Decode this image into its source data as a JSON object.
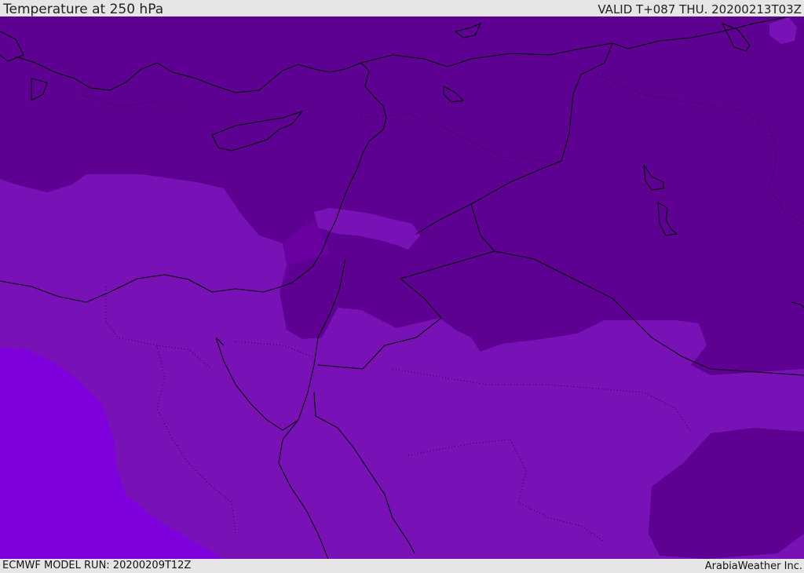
{
  "header": {
    "title": "Temperature at 250 hPa",
    "valid_time": "VALID T+087 THU. 20200213T03Z"
  },
  "footer": {
    "model_run": "ECMWF MODEL RUN: 20200209T12Z",
    "credit": "ArabiaWeather Inc."
  },
  "map": {
    "field": "temperature",
    "level_hpa": 250,
    "colors": {
      "coldest": "#5c0090",
      "cold": "#6a00a0",
      "medium": "#7812b6",
      "warm": "#7f00dc",
      "coastline": "#000000"
    }
  }
}
